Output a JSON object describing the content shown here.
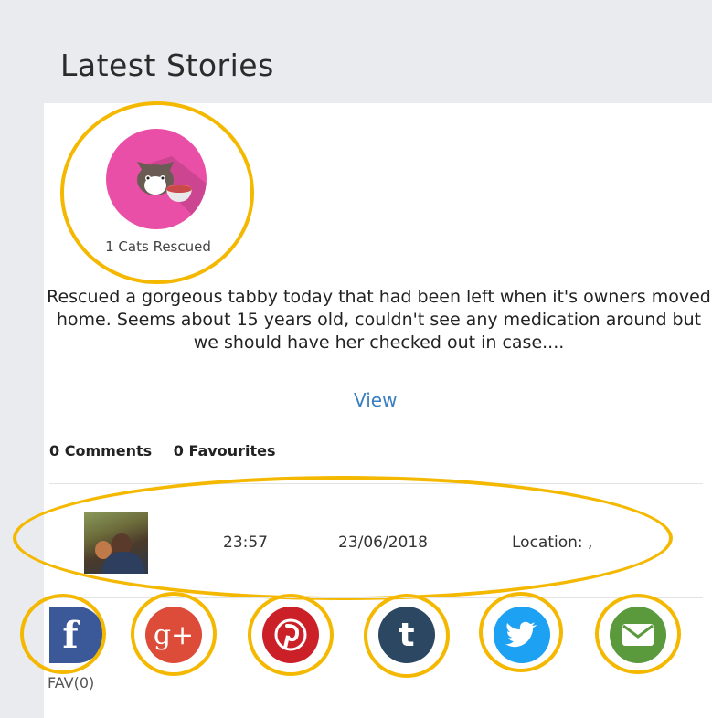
{
  "page": {
    "heading": "Latest Stories"
  },
  "badge": {
    "label": "1 Cats Rescued",
    "icon": "cat-bowl-icon",
    "color": "#e94fa6"
  },
  "story": {
    "text": "Rescued a gorgeous tabby today that had been left when it's owners moved home. Seems about 15 years old, couldn't see any medication around but we should have her checked out in case....",
    "view_label": "View"
  },
  "stats": {
    "comments": "0 Comments",
    "favourites": "0 Favourites"
  },
  "meta": {
    "time": "23:57",
    "date": "23/06/2018",
    "location": "Location: ,"
  },
  "social": {
    "facebook": {
      "glyph": "f",
      "color": "#3b5998"
    },
    "googleplus": {
      "glyph": "g+",
      "color": "#dd4b39"
    },
    "pinterest": {
      "glyph": "P",
      "color": "#cb2027"
    },
    "tumblr": {
      "glyph": "t",
      "color": "#2c4762"
    },
    "twitter": {
      "color": "#1da1f2"
    },
    "email": {
      "color": "#5b9a3c"
    }
  },
  "fav": {
    "label": "FAV(0)"
  }
}
